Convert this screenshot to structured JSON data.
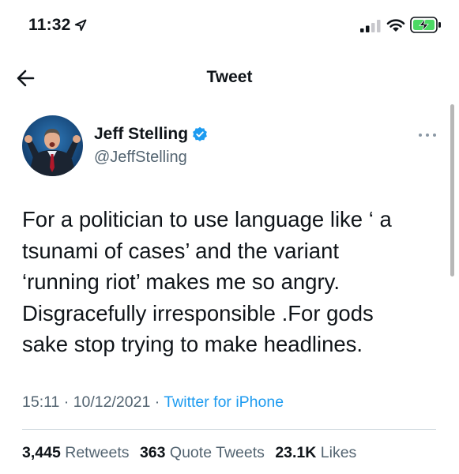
{
  "status_bar": {
    "time": "11:32",
    "icons": [
      "location-arrow-icon",
      "cellular-signal-icon",
      "wifi-icon",
      "battery-charging-icon"
    ],
    "battery_color": "#4cd964"
  },
  "header": {
    "back_icon": "arrow-left-icon",
    "title": "Tweet"
  },
  "author": {
    "name": "Jeff Stelling",
    "handle": "@JeffStelling",
    "verified": true,
    "verified_color": "#1d9bf0"
  },
  "tweet": {
    "text": "For a politician to use language like ‘ a\ntsunami of cases’ and the variant\n‘running riot’ makes me so angry.\nDisgracefully irresponsible .For gods\nsake stop trying to make headlines.",
    "time": "15:11",
    "separator": "·",
    "date": "10/12/2021",
    "source": "Twitter for iPhone"
  },
  "stats": {
    "retweets_count": "3,445",
    "retweets_label": "Retweets",
    "quotes_count": "363",
    "quotes_label": "Quote Tweets",
    "likes_count": "23.1K",
    "likes_label": "Likes"
  },
  "colors": {
    "link": "#1d9bf0",
    "secondary_text": "#536471",
    "primary_text": "#0f1419"
  }
}
